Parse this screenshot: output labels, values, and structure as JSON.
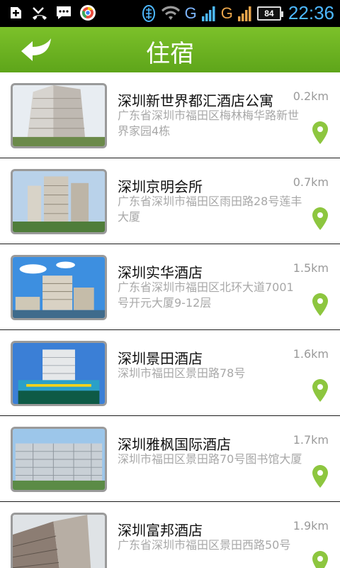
{
  "statusbar": {
    "left_icons": [
      "add-icon",
      "missed-call-icon",
      "sms-icon",
      "browser-icon"
    ],
    "network_1": "G",
    "network_2": "G",
    "battery_level": "84",
    "time": "22:36"
  },
  "header": {
    "title": "住宿",
    "back_icon": "back-arrow-icon"
  },
  "hotels": [
    {
      "name": "深圳新世界都汇酒店公寓",
      "distance": "0.2km",
      "address": "广东省深圳市福田区梅林梅华路新世界家园4栋"
    },
    {
      "name": "深圳京明会所",
      "distance": "0.7km",
      "address": "广东省深圳市福田区雨田路28号莲丰大厦"
    },
    {
      "name": "深圳实华酒店",
      "distance": "1.5km",
      "address": "广东省深圳市福田区北环大道7001号开元大厦9-12层"
    },
    {
      "name": "深圳景田酒店",
      "distance": "1.6km",
      "address": "深圳市福田区景田路78号"
    },
    {
      "name": "深圳雅枫国际酒店",
      "distance": "1.7km",
      "address": "深圳市福田区景田路70号图书馆大厦"
    },
    {
      "name": "深圳富邦酒店",
      "distance": "1.9km",
      "address": "广东省深圳市福田区景田西路50号"
    }
  ],
  "colors": {
    "header_green": "#6db322",
    "pin_green": "#8dc63f",
    "time_blue": "#4db8ff"
  }
}
